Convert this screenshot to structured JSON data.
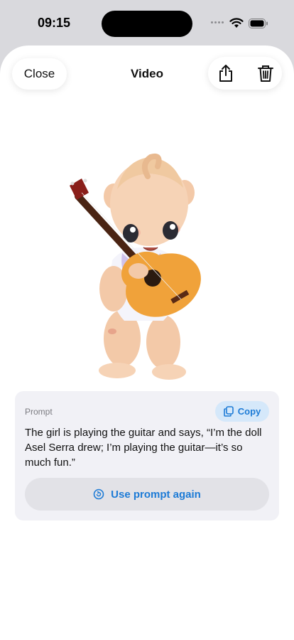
{
  "status": {
    "time": "09:15"
  },
  "nav": {
    "close_label": "Close",
    "title": "Video"
  },
  "video": {
    "subject": "baby doll playing guitar"
  },
  "prompt": {
    "label": "Prompt",
    "copy_label": "Copy",
    "text": "The girl is playing the guitar and says, “I’m the doll Asel Serra drew; I’m playing the guitar—it’s so much fun.”",
    "reuse_label": "Use prompt again"
  },
  "colors": {
    "accent": "#1d7bd6",
    "card_bg": "#f1f1f6",
    "copy_bg": "#d5e8fa"
  },
  "icons": [
    "wifi-icon",
    "battery-icon",
    "share-icon",
    "trash-icon",
    "copy-icon",
    "refresh-icon"
  ]
}
